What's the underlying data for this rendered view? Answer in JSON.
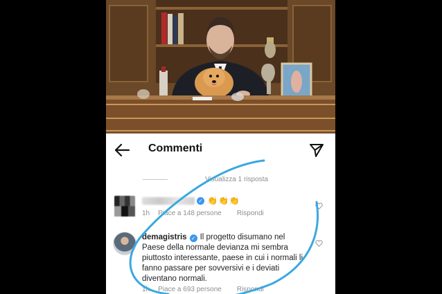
{
  "header": {
    "title": "Commenti"
  },
  "replies": {
    "view_label": "Visualizza 1 risposta"
  },
  "comments": [
    {
      "emojis": "👏👏👏",
      "time": "1h",
      "likes": "Piace a 148 persone",
      "reply_label": "Rispondi"
    },
    {
      "username": "demagistris",
      "text": "Il progetto disumano nel Paese della normale devianza mi sembra piuttosto interessante, paese in cui i normali li fanno passare per sovversivi e i deviati diventano normali.",
      "time": "1h",
      "likes": "Piace a 693 persone",
      "reply_label": "Rispondi"
    }
  ],
  "icons": {
    "back": "back-arrow-icon",
    "send": "send-icon",
    "heart": "heart-icon",
    "verified": "verified-icon"
  },
  "colors": {
    "verified": "#3897f0",
    "meta_text": "#8e8e8e",
    "scribble": "#3aa8e0"
  }
}
